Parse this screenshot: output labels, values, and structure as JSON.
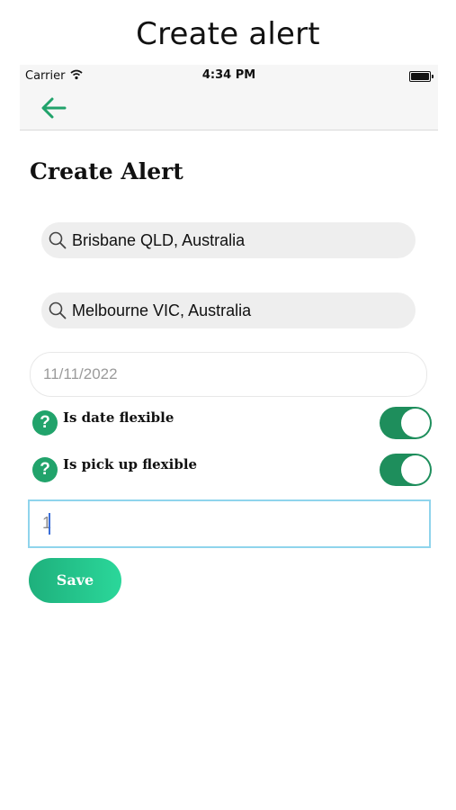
{
  "caption": "Create alert",
  "status_bar": {
    "carrier": "Carrier",
    "time": "4:34 PM",
    "wifi_icon": "wifi-icon",
    "battery_icon": "battery-icon"
  },
  "nav": {
    "back_icon": "arrow-left-icon",
    "accent": "#21a36b"
  },
  "page": {
    "title": "Create Alert",
    "from": {
      "icon": "search-icon",
      "value": "Brisbane QLD, Australia"
    },
    "to": {
      "icon": "search-icon",
      "value": "Melbourne VIC, Australia"
    },
    "date": {
      "value": "11/11/2022"
    },
    "date_flexible": {
      "help_icon": "question-icon",
      "label": "Is date flexible",
      "on": true
    },
    "pickup_flexible": {
      "help_icon": "question-icon",
      "label": "Is pick up flexible",
      "on": true
    },
    "input": {
      "value": "1"
    },
    "save_label": "Save"
  },
  "colors": {
    "toggle_on": "#1e8e5c",
    "help": "#21a36b",
    "save_start": "#1eb07c",
    "save_end": "#2bd79a",
    "focus_border": "#8fd4ec"
  }
}
